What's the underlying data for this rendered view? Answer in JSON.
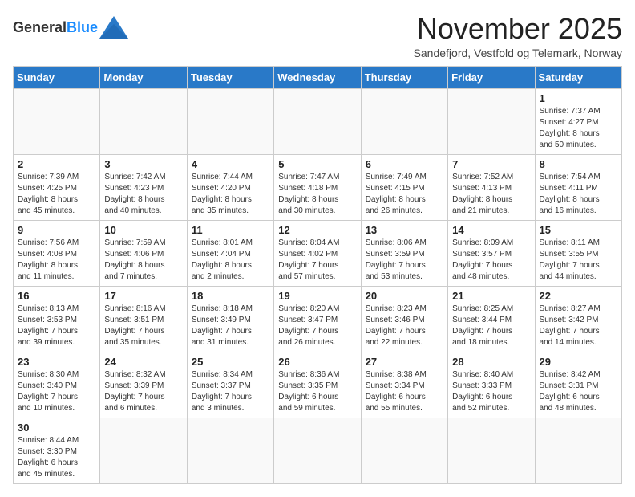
{
  "header": {
    "logo_general": "General",
    "logo_blue": "Blue",
    "month_title": "November 2025",
    "subtitle": "Sandefjord, Vestfold og Telemark, Norway"
  },
  "days_of_week": [
    "Sunday",
    "Monday",
    "Tuesday",
    "Wednesday",
    "Thursday",
    "Friday",
    "Saturday"
  ],
  "weeks": [
    [
      {
        "day": "",
        "info": ""
      },
      {
        "day": "",
        "info": ""
      },
      {
        "day": "",
        "info": ""
      },
      {
        "day": "",
        "info": ""
      },
      {
        "day": "",
        "info": ""
      },
      {
        "day": "",
        "info": ""
      },
      {
        "day": "1",
        "info": "Sunrise: 7:37 AM\nSunset: 4:27 PM\nDaylight: 8 hours\nand 50 minutes."
      }
    ],
    [
      {
        "day": "2",
        "info": "Sunrise: 7:39 AM\nSunset: 4:25 PM\nDaylight: 8 hours\nand 45 minutes."
      },
      {
        "day": "3",
        "info": "Sunrise: 7:42 AM\nSunset: 4:23 PM\nDaylight: 8 hours\nand 40 minutes."
      },
      {
        "day": "4",
        "info": "Sunrise: 7:44 AM\nSunset: 4:20 PM\nDaylight: 8 hours\nand 35 minutes."
      },
      {
        "day": "5",
        "info": "Sunrise: 7:47 AM\nSunset: 4:18 PM\nDaylight: 8 hours\nand 30 minutes."
      },
      {
        "day": "6",
        "info": "Sunrise: 7:49 AM\nSunset: 4:15 PM\nDaylight: 8 hours\nand 26 minutes."
      },
      {
        "day": "7",
        "info": "Sunrise: 7:52 AM\nSunset: 4:13 PM\nDaylight: 8 hours\nand 21 minutes."
      },
      {
        "day": "8",
        "info": "Sunrise: 7:54 AM\nSunset: 4:11 PM\nDaylight: 8 hours\nand 16 minutes."
      }
    ],
    [
      {
        "day": "9",
        "info": "Sunrise: 7:56 AM\nSunset: 4:08 PM\nDaylight: 8 hours\nand 11 minutes."
      },
      {
        "day": "10",
        "info": "Sunrise: 7:59 AM\nSunset: 4:06 PM\nDaylight: 8 hours\nand 7 minutes."
      },
      {
        "day": "11",
        "info": "Sunrise: 8:01 AM\nSunset: 4:04 PM\nDaylight: 8 hours\nand 2 minutes."
      },
      {
        "day": "12",
        "info": "Sunrise: 8:04 AM\nSunset: 4:02 PM\nDaylight: 7 hours\nand 57 minutes."
      },
      {
        "day": "13",
        "info": "Sunrise: 8:06 AM\nSunset: 3:59 PM\nDaylight: 7 hours\nand 53 minutes."
      },
      {
        "day": "14",
        "info": "Sunrise: 8:09 AM\nSunset: 3:57 PM\nDaylight: 7 hours\nand 48 minutes."
      },
      {
        "day": "15",
        "info": "Sunrise: 8:11 AM\nSunset: 3:55 PM\nDaylight: 7 hours\nand 44 minutes."
      }
    ],
    [
      {
        "day": "16",
        "info": "Sunrise: 8:13 AM\nSunset: 3:53 PM\nDaylight: 7 hours\nand 39 minutes."
      },
      {
        "day": "17",
        "info": "Sunrise: 8:16 AM\nSunset: 3:51 PM\nDaylight: 7 hours\nand 35 minutes."
      },
      {
        "day": "18",
        "info": "Sunrise: 8:18 AM\nSunset: 3:49 PM\nDaylight: 7 hours\nand 31 minutes."
      },
      {
        "day": "19",
        "info": "Sunrise: 8:20 AM\nSunset: 3:47 PM\nDaylight: 7 hours\nand 26 minutes."
      },
      {
        "day": "20",
        "info": "Sunrise: 8:23 AM\nSunset: 3:46 PM\nDaylight: 7 hours\nand 22 minutes."
      },
      {
        "day": "21",
        "info": "Sunrise: 8:25 AM\nSunset: 3:44 PM\nDaylight: 7 hours\nand 18 minutes."
      },
      {
        "day": "22",
        "info": "Sunrise: 8:27 AM\nSunset: 3:42 PM\nDaylight: 7 hours\nand 14 minutes."
      }
    ],
    [
      {
        "day": "23",
        "info": "Sunrise: 8:30 AM\nSunset: 3:40 PM\nDaylight: 7 hours\nand 10 minutes."
      },
      {
        "day": "24",
        "info": "Sunrise: 8:32 AM\nSunset: 3:39 PM\nDaylight: 7 hours\nand 6 minutes."
      },
      {
        "day": "25",
        "info": "Sunrise: 8:34 AM\nSunset: 3:37 PM\nDaylight: 7 hours\nand 3 minutes."
      },
      {
        "day": "26",
        "info": "Sunrise: 8:36 AM\nSunset: 3:35 PM\nDaylight: 6 hours\nand 59 minutes."
      },
      {
        "day": "27",
        "info": "Sunrise: 8:38 AM\nSunset: 3:34 PM\nDaylight: 6 hours\nand 55 minutes."
      },
      {
        "day": "28",
        "info": "Sunrise: 8:40 AM\nSunset: 3:33 PM\nDaylight: 6 hours\nand 52 minutes."
      },
      {
        "day": "29",
        "info": "Sunrise: 8:42 AM\nSunset: 3:31 PM\nDaylight: 6 hours\nand 48 minutes."
      }
    ],
    [
      {
        "day": "30",
        "info": "Sunrise: 8:44 AM\nSunset: 3:30 PM\nDaylight: 6 hours\nand 45 minutes."
      },
      {
        "day": "",
        "info": ""
      },
      {
        "day": "",
        "info": ""
      },
      {
        "day": "",
        "info": ""
      },
      {
        "day": "",
        "info": ""
      },
      {
        "day": "",
        "info": ""
      },
      {
        "day": "",
        "info": ""
      }
    ]
  ]
}
